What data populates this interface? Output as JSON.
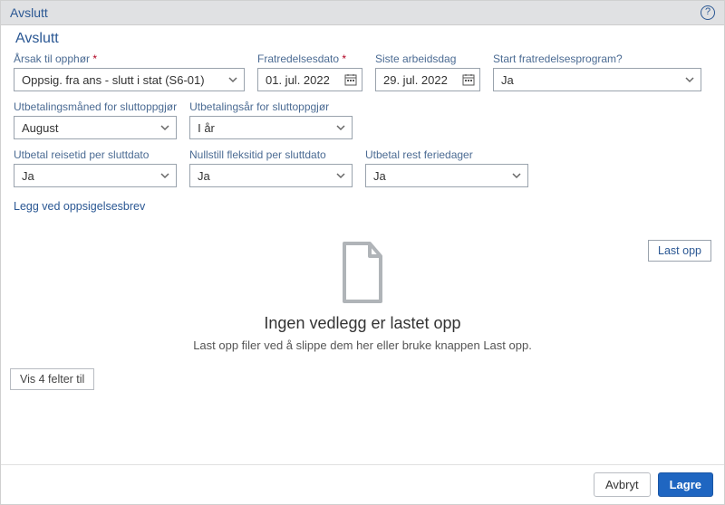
{
  "header": {
    "title": "Avslutt"
  },
  "page": {
    "title": "Avslutt"
  },
  "fields": {
    "reason": {
      "label": "Årsak til opphør",
      "required": true,
      "value": "Oppsig. fra ans - slutt i stat (S6-01)"
    },
    "fromDate": {
      "label": "Fratredelsesdato",
      "required": true,
      "value": "01. jul. 2022"
    },
    "lastDay": {
      "label": "Siste arbeidsdag",
      "value": "29. jul. 2022"
    },
    "startProg": {
      "label": "Start fratredelsesprogram?",
      "value": "Ja"
    },
    "payMonth": {
      "label": "Utbetalingsmåned for sluttoppgjør",
      "value": "August"
    },
    "payYear": {
      "label": "Utbetalingsår for sluttoppgjør",
      "value": "I år"
    },
    "travel": {
      "label": "Utbetal reisetid per sluttdato",
      "value": "Ja"
    },
    "flex": {
      "label": "Nullstill fleksitid per sluttdato",
      "value": "Ja"
    },
    "vacation": {
      "label": "Utbetal rest feriedager",
      "value": "Ja"
    }
  },
  "attach": {
    "link": "Legg ved oppsigelsesbrev",
    "uploadBtn": "Last opp",
    "emptyTitle": "Ingen vedlegg er lastet opp",
    "emptySub": "Last opp filer ved å slippe dem her eller bruke knappen Last opp."
  },
  "moreFields": "Vis 4 felter til",
  "footer": {
    "cancel": "Avbryt",
    "save": "Lagre"
  }
}
